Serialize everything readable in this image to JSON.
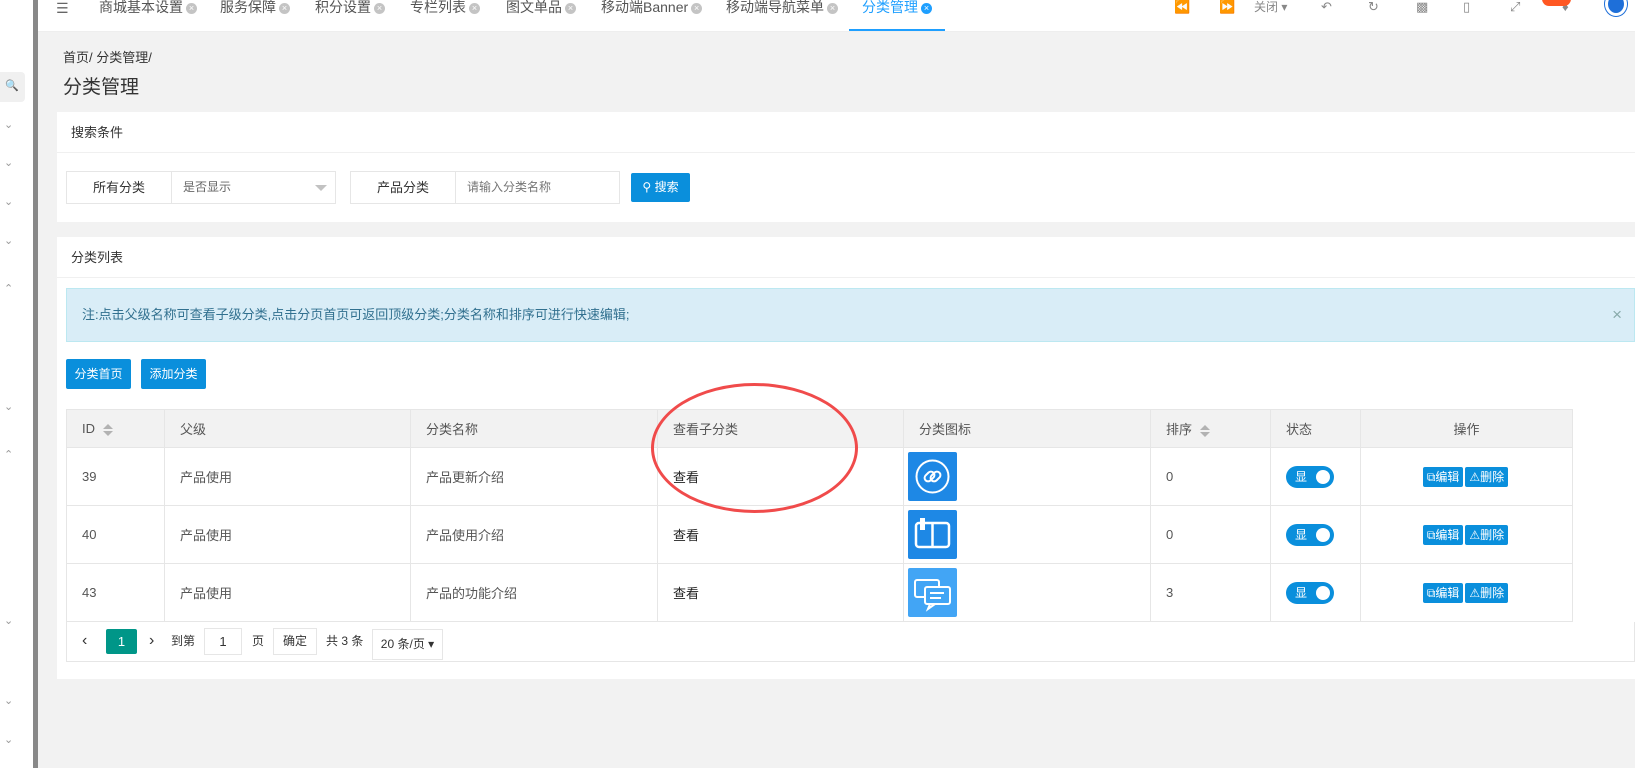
{
  "tabs": [
    {
      "label": "商城基本设置",
      "active": false
    },
    {
      "label": "服务保障",
      "active": false
    },
    {
      "label": "积分设置",
      "active": false
    },
    {
      "label": "专栏列表",
      "active": false
    },
    {
      "label": "图文单品",
      "active": false
    },
    {
      "label": "移动端Banner",
      "active": false
    },
    {
      "label": "移动端导航菜单",
      "active": false
    },
    {
      "label": "分类管理",
      "active": true
    }
  ],
  "toolbar": {
    "close_label": "关闭"
  },
  "breadcrumb": {
    "home": "首页",
    "sep": "/",
    "current": "分类管理",
    "trail": "/"
  },
  "page_title": "分类管理",
  "search": {
    "header": "搜索条件",
    "filter1_label": "所有分类",
    "filter1_value": "是否显示",
    "filter2_label": "产品分类",
    "filter2_placeholder": "请输入分类名称",
    "search_button": "搜索"
  },
  "list": {
    "header": "分类列表",
    "notice": "注:点击父级名称可查看子级分类,点击分页首页可返回顶级分类;分类名称和排序可进行快速编辑;",
    "notice_close": "×",
    "home_button": "分类首页",
    "add_button": "添加分类",
    "columns": [
      "ID",
      "父级",
      "分类名称",
      "查看子分类",
      "分类图标",
      "排序",
      "状态",
      "操作"
    ],
    "rows": [
      {
        "id": "39",
        "parent": "产品使用",
        "name": "产品更新介绍",
        "view": "查看",
        "icon": "link-icon",
        "sort": "0",
        "status": "显",
        "edit": "编辑",
        "delete": "删除"
      },
      {
        "id": "40",
        "parent": "产品使用",
        "name": "产品使用介绍",
        "view": "查看",
        "icon": "book-icon",
        "sort": "0",
        "status": "显",
        "edit": "编辑",
        "delete": "删除"
      },
      {
        "id": "43",
        "parent": "产品使用",
        "name": "产品的功能介绍",
        "view": "查看",
        "icon": "chat-icon",
        "sort": "3",
        "status": "显",
        "edit": "编辑",
        "delete": "删除"
      }
    ]
  },
  "pagination": {
    "current": "1",
    "goto_prefix": "到第",
    "goto_value": "1",
    "goto_suffix": "页",
    "confirm": "确定",
    "total": "共 3 条",
    "page_size": "20 条/页"
  },
  "colors": {
    "primary": "#0a8fdc",
    "active_tab": "#1e9fff",
    "pager_current": "#009688",
    "annotation": "#f04b4b"
  }
}
